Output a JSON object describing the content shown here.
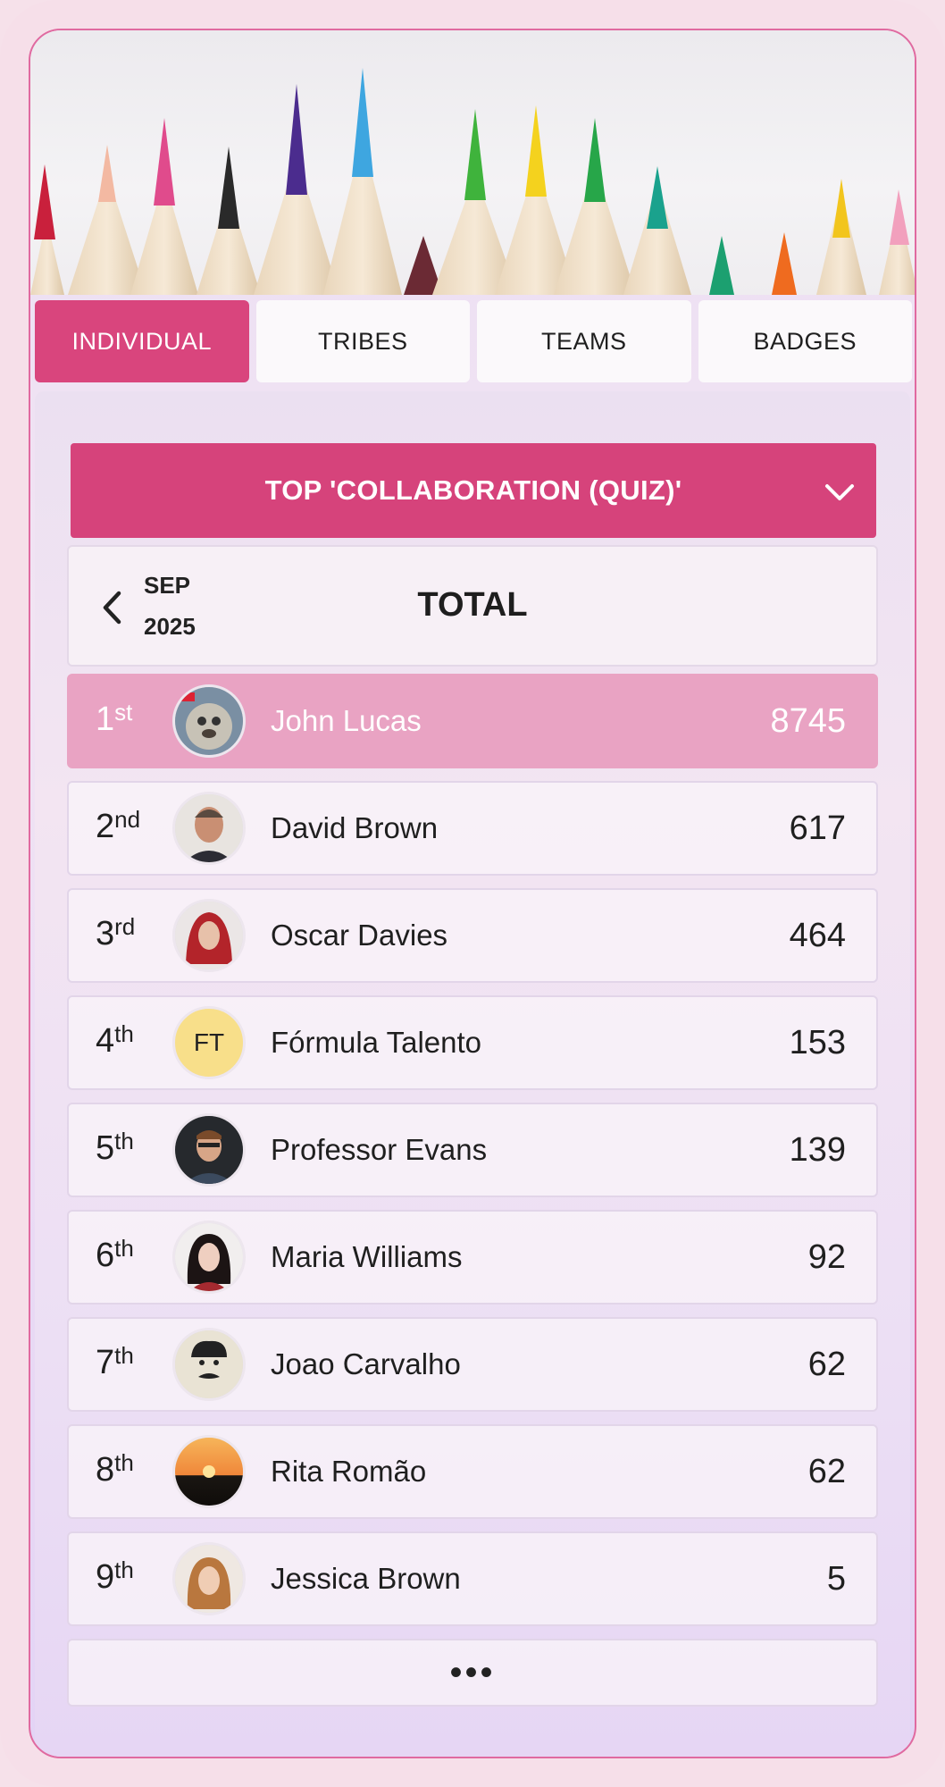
{
  "tabs": [
    {
      "label": "INDIVIDUAL",
      "active": true
    },
    {
      "label": "TRIBES",
      "active": false
    },
    {
      "label": "TEAMS",
      "active": false
    },
    {
      "label": "BADGES",
      "active": false
    }
  ],
  "dropdown": {
    "label": "TOP 'COLLABORATION (QUIZ)'",
    "icon": "chevron-down-icon"
  },
  "period": {
    "month": "SEP",
    "year": "2025",
    "title": "TOTAL",
    "back_icon": "chevron-left-icon"
  },
  "leaderboard": [
    {
      "rank": "1",
      "suffix": "st",
      "name": "John Lucas",
      "score": "8745"
    },
    {
      "rank": "2",
      "suffix": "nd",
      "name": "David Brown",
      "score": "617"
    },
    {
      "rank": "3",
      "suffix": "rd",
      "name": "Oscar Davies",
      "score": "464"
    },
    {
      "rank": "4",
      "suffix": "th",
      "name": "Fórmula Talento",
      "score": "153",
      "initials": "FT"
    },
    {
      "rank": "5",
      "suffix": "th",
      "name": "Professor Evans",
      "score": "139"
    },
    {
      "rank": "6",
      "suffix": "th",
      "name": "Maria Williams",
      "score": "92"
    },
    {
      "rank": "7",
      "suffix": "th",
      "name": "Joao Carvalho",
      "score": "62"
    },
    {
      "rank": "8",
      "suffix": "th",
      "name": "Rita Romão",
      "score": "62"
    },
    {
      "rank": "9",
      "suffix": "th",
      "name": "Jessica Brown",
      "score": "5"
    }
  ],
  "more_label": "•••",
  "colors": {
    "accent": "#d9457d",
    "highlight_row": "#e9a3c3"
  }
}
